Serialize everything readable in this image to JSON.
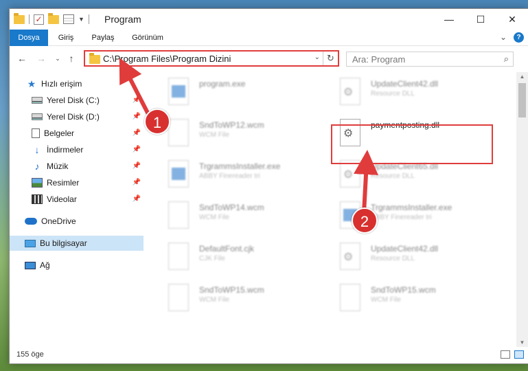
{
  "window": {
    "title": "Program"
  },
  "ribbon": {
    "tabs": [
      "Dosya",
      "Giriş",
      "Paylaş",
      "Görünüm"
    ]
  },
  "address": {
    "path": "C:\\Program Files\\Program Dizini"
  },
  "search": {
    "placeholder": "Ara: Program"
  },
  "nav": {
    "items": [
      {
        "label": "Hızlı erişim",
        "icon": "star-icon"
      },
      {
        "label": "Yerel Disk (C:)",
        "icon": "drive-icon",
        "pinned": true
      },
      {
        "label": "Yerel Disk (D:)",
        "icon": "drive-icon",
        "pinned": true
      },
      {
        "label": "Belgeler",
        "icon": "document-icon",
        "pinned": true
      },
      {
        "label": "İndirmeler",
        "icon": "download-icon",
        "pinned": true
      },
      {
        "label": "Müzik",
        "icon": "music-icon",
        "pinned": true
      },
      {
        "label": "Resimler",
        "icon": "pictures-icon",
        "pinned": true
      },
      {
        "label": "Videolar",
        "icon": "video-icon",
        "pinned": true
      },
      {
        "label": "OneDrive",
        "icon": "cloud-icon"
      },
      {
        "label": "Bu bilgisayar",
        "icon": "computer-icon",
        "selected": true
      },
      {
        "label": "Ağ",
        "icon": "network-icon"
      }
    ]
  },
  "files": [
    {
      "name": "program.exe",
      "type": ""
    },
    {
      "name": "UpdateClient42.dll",
      "type": "Resource DLL"
    },
    {
      "name": "SndToWP12.wcm",
      "type": "WCM File"
    },
    {
      "name": "paymentposting.dll",
      "type": ""
    },
    {
      "name": "TrgrammsInstaller.exe",
      "type": "ABBY Finereader tri"
    },
    {
      "name": "UpdateClient65.dll",
      "type": "Resource DLL"
    },
    {
      "name": "SndToWP14.wcm",
      "type": "WCM File"
    },
    {
      "name": "TrgrammsInstaller.exe",
      "type": "ABBY Finereader tri"
    },
    {
      "name": "DefaultFont.cjk",
      "type": "CJK File"
    },
    {
      "name": "UpdateClient42.dll",
      "type": "Resource DLL"
    },
    {
      "name": "SndToWP15.wcm",
      "type": "WCM File"
    },
    {
      "name": "SndToWP15.wcm",
      "type": "WCM File"
    }
  ],
  "status": {
    "count": "155 öge"
  },
  "annotations": {
    "step1": "1",
    "step2": "2"
  },
  "colors": {
    "accent": "#1979ca",
    "highlight": "#e03c3c",
    "selected": "#cce4f7"
  }
}
